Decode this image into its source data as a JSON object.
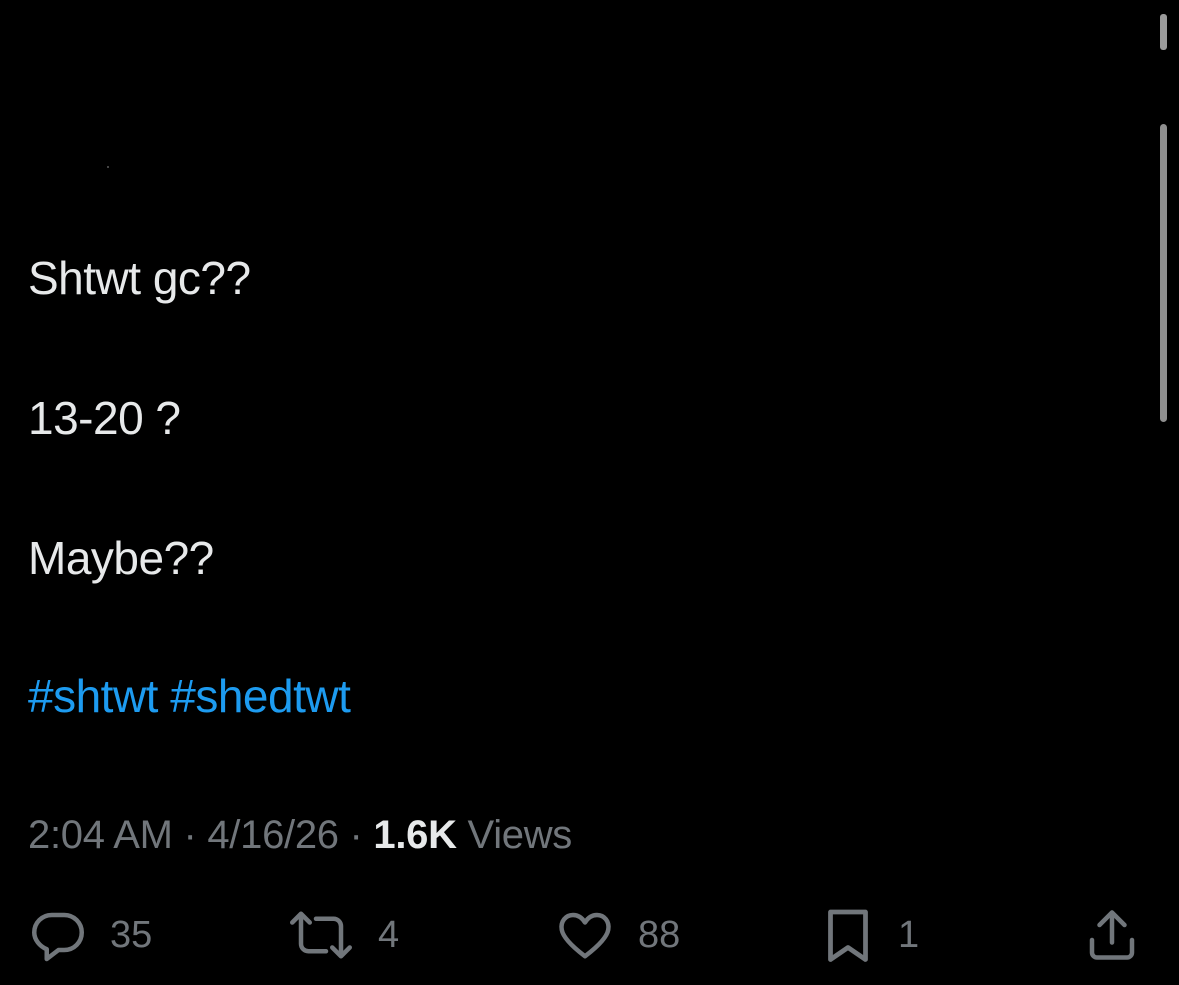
{
  "tweet": {
    "lines": [
      "Shtwt gc??",
      "13-20 ?",
      "Maybe??"
    ],
    "hashtags": [
      "#shtwt",
      "#shedtwt"
    ]
  },
  "meta": {
    "time": "2:04 AM",
    "separator": "·",
    "date": "4/16/26",
    "views_count": "1.6K",
    "views_label": "Views"
  },
  "actions": {
    "replies": "35",
    "retweets": "4",
    "likes": "88",
    "bookmarks": "1"
  },
  "icons": {
    "reply": "reply-bubble-icon",
    "retweet": "retweet-icon",
    "like": "heart-icon",
    "bookmark": "bookmark-icon",
    "share": "share-icon"
  },
  "colors": {
    "background": "#000000",
    "text": "#e7e9ea",
    "muted": "#71767b",
    "link": "#1d9bf0"
  }
}
